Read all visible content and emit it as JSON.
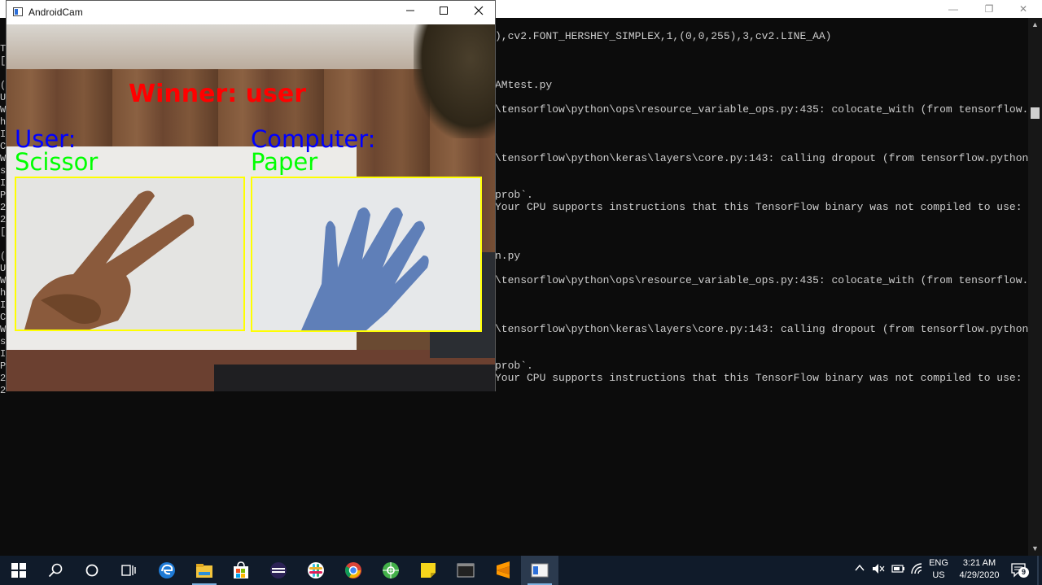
{
  "console": {
    "lines": [
      {
        "text": "),cv2.FONT_HERSHEY_SIMPLEX,1,(0,0,255),3,cv2.LINE_AA)",
        "row": 0
      },
      {
        "text": "AMtest.py",
        "row": 1
      },
      {
        "text": "\\tensorflow\\python\\ops\\resource_variable_ops.py:435: colocate_with (from tensorflow.pyt",
        "row": 2
      },
      {
        "text": "\\tensorflow\\python\\keras\\layers\\core.py:143: calling dropout (from tensorflow.python.op",
        "row": 3
      },
      {
        "text": "prob`.",
        "row": 4
      },
      {
        "text": "Your CPU supports instructions that this TensorFlow binary was not compiled to use: AVX",
        "row": 5
      },
      {
        "text": "n.py",
        "row": 6
      },
      {
        "text": "\\tensorflow\\python\\ops\\resource_variable_ops.py:435: colocate_with (from tensorflow.pyt",
        "row": 7
      },
      {
        "text": "\\tensorflow\\python\\keras\\layers\\core.py:143: calling dropout (from tensorflow.python.op",
        "row": 8
      },
      {
        "text": "prob`.",
        "row": 9
      },
      {
        "text": "Your CPU supports instructions that this TensorFlow binary was not compiled to use: AVX",
        "row": 10
      }
    ],
    "left_chars": [
      "T",
      "[",
      "",
      "(",
      "U",
      "W",
      "h",
      "I",
      "C",
      "W",
      "s",
      "I",
      "P",
      "2",
      "2",
      "[",
      "",
      "(",
      "U",
      "W",
      "h",
      "I",
      "C",
      "W",
      "s",
      "I",
      "P",
      "2",
      "2"
    ]
  },
  "cam": {
    "title": "AndroidCam",
    "winner_text": "Winner: user",
    "user_label": "User:",
    "user_move": "Scissor",
    "computer_label": "Computer:",
    "computer_move": "Paper",
    "colors": {
      "winner": "#ff0000",
      "label": "#0000ff",
      "move": "#00ff00",
      "box": "#ffff00"
    }
  },
  "taskbar": {
    "lang_top": "ENG",
    "lang_bottom": "US",
    "time": "3:21 AM",
    "date": "4/29/2020",
    "notification_count": "9",
    "apps": [
      "windows-start-icon",
      "search-icon",
      "cortana-icon",
      "task-view-icon",
      "edge-icon",
      "file-explorer-icon",
      "store-icon",
      "eclipse-icon",
      "slack-icon",
      "chrome-icon",
      "anaconda-icon",
      "sticky-notes-icon",
      "terminal-icon",
      "sublime-text-icon",
      "androidcam-icon"
    ]
  }
}
